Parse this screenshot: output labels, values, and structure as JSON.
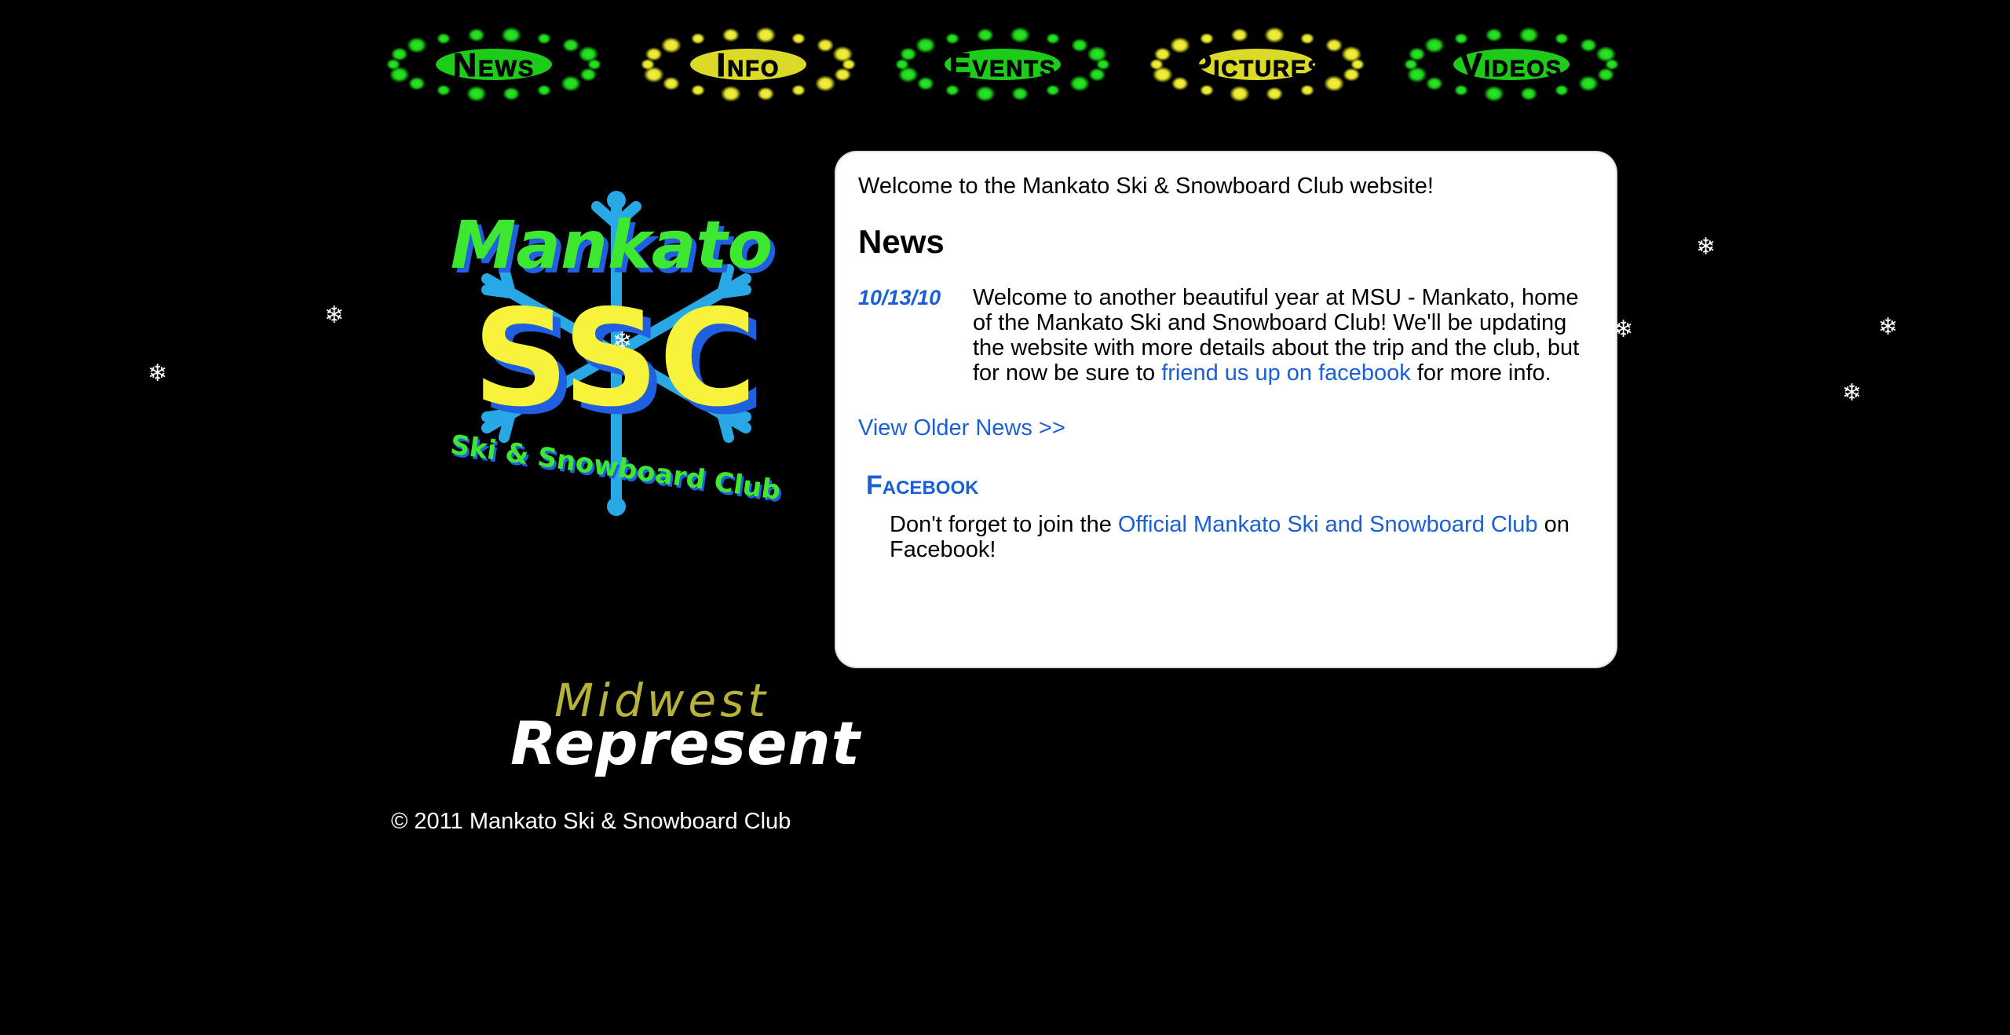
{
  "nav": {
    "items": [
      {
        "label": "News",
        "color": "#1fd61a",
        "accent": "#2ee82a"
      },
      {
        "label": "Info",
        "color": "#e8e62a",
        "accent": "#f2f04a"
      },
      {
        "label": "Events",
        "color": "#1fd61a",
        "accent": "#2ee82a"
      },
      {
        "label": "Pictures",
        "color": "#e8e62a",
        "accent": "#f2f04a"
      },
      {
        "label": "Videos",
        "color": "#1fd61a",
        "accent": "#2ee82a"
      }
    ]
  },
  "logo": {
    "top_text": "Mankato",
    "center_text": "SSC",
    "bottom_text": "Ski & Snowboard Club",
    "colors": {
      "green": "#3ee830",
      "yellow": "#f7f23a",
      "blue": "#1f5fe0",
      "snowflake": "#29a8e6"
    }
  },
  "represent": {
    "line1": "Midwest",
    "line2": "Represent"
  },
  "footer": {
    "text": "© 2011 Mankato Ski & Snowboard Club"
  },
  "content": {
    "welcome": "Welcome to the Mankato Ski & Snowboard Club website!",
    "news_heading": "News",
    "news_entries": [
      {
        "date": "10/13/10",
        "text_before": "Welcome to another beautiful year at MSU - Mankato, home of the Mankato Ski and Snowboard Club! We'll be updating the website with more details about the trip and the club, but for now be sure to ",
        "link": "friend us up on facebook",
        "text_after": " for more info."
      }
    ],
    "older_news_link": "View Older News >>",
    "facebook": {
      "heading": "Facebook",
      "text_before": "Don't forget to join the ",
      "link": "Official Mankato Ski and Snowboard Club",
      "text_after": " on Facebook!"
    }
  },
  "colors": {
    "background": "#000000",
    "link": "#1a5fd6",
    "panel": "#ffffff"
  },
  "snowflake_icon": "snowflake-icon"
}
